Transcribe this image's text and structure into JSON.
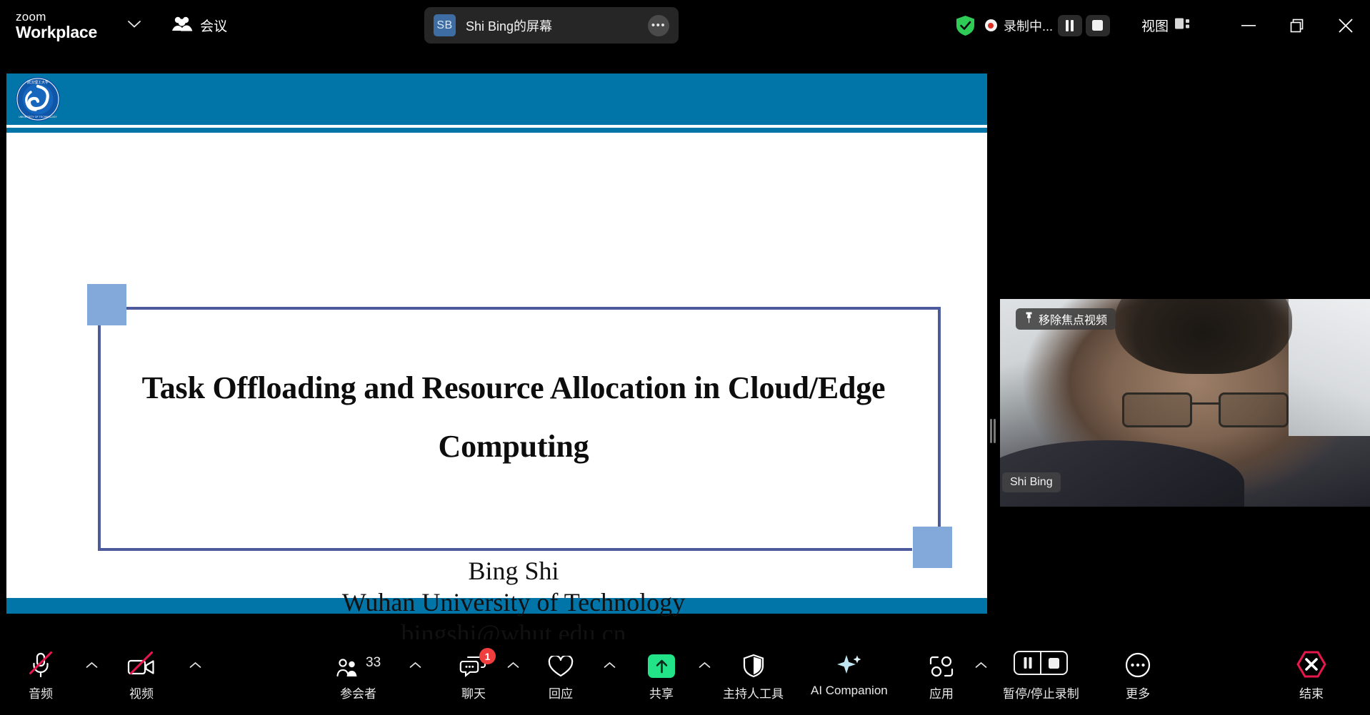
{
  "app": {
    "brand_line1": "zoom",
    "brand_line2": "Workplace",
    "brand_caret_icon": "chevron-down-icon",
    "meetings_icon": "people-group-icon",
    "meetings_label": "会议"
  },
  "share_indicator": {
    "avatar_initials": "SB",
    "title": "Shi Bing的屏幕",
    "more_icon": "ellipsis-icon"
  },
  "titlebar_right": {
    "shield_icon": "shield-check-icon",
    "shield_color": "#2ecc57",
    "recording_icon": "record-dot-icon",
    "recording_label": "录制中...",
    "pause_icon": "pause-icon",
    "stop_icon": "stop-square-icon",
    "view_label": "视图",
    "view_icon": "layout-panel-icon"
  },
  "window_controls": {
    "minimize_icon": "minimize-icon",
    "restore_icon": "restore-window-icon",
    "close_icon": "close-icon"
  },
  "slide": {
    "logo_icon": "whut-university-logo",
    "logo_text_top": "武汉理工大学",
    "logo_text_ring": "WUHAN UNIVERSITY OF TECHNOLOGY",
    "title": "Task Offloading and Resource Allocation in Cloud/Edge Computing",
    "author": "Bing Shi",
    "affiliation": "Wuhan University of Technology",
    "email": "bingshi@whut.edu.cn",
    "bar_color": "#0275a8",
    "accent_square_color": "#82a9da",
    "frame_line_color": "#4d5b9c"
  },
  "video_tile": {
    "unpin_icon": "pin-icon",
    "unpin_label": "移除焦点视频",
    "participant_name": "Shi Bing"
  },
  "divider": {
    "handle_icon": "drag-handle-icon"
  },
  "toolbar": {
    "audio": {
      "label": "音频",
      "icon": "microphone-muted-icon",
      "muted": true,
      "caret_icon": "chevron-up-icon"
    },
    "video": {
      "label": "视频",
      "icon": "camera-muted-icon",
      "muted": true,
      "caret_icon": "chevron-up-icon"
    },
    "participants": {
      "label": "参会者",
      "icon": "participants-icon",
      "count": "33",
      "caret_icon": "chevron-up-icon"
    },
    "chat": {
      "label": "聊天",
      "icon": "chat-bubble-icon",
      "badge": "1",
      "caret_icon": "chevron-up-icon"
    },
    "reactions": {
      "label": "回应",
      "icon": "heart-icon",
      "caret_icon": "chevron-up-icon"
    },
    "share": {
      "label": "共享",
      "icon": "share-screen-arrow-up-icon",
      "accent": "#22e388",
      "caret_icon": "chevron-up-icon"
    },
    "host_tools": {
      "label": "主持人工具",
      "icon": "shield-icon"
    },
    "ai_companion": {
      "label": "AI Companion",
      "icon": "sparkle-icon"
    },
    "apps": {
      "label": "应用",
      "icon": "apps-icon",
      "caret_icon": "chevron-up-icon"
    },
    "recording": {
      "label": "暂停/停止录制",
      "pause_icon": "pause-icon",
      "stop_icon": "stop-square-icon"
    },
    "more": {
      "label": "更多",
      "icon": "ellipsis-circle-icon"
    },
    "end": {
      "label": "结束",
      "icon": "end-call-hexagon-icon",
      "accent": "#e8174b"
    }
  }
}
